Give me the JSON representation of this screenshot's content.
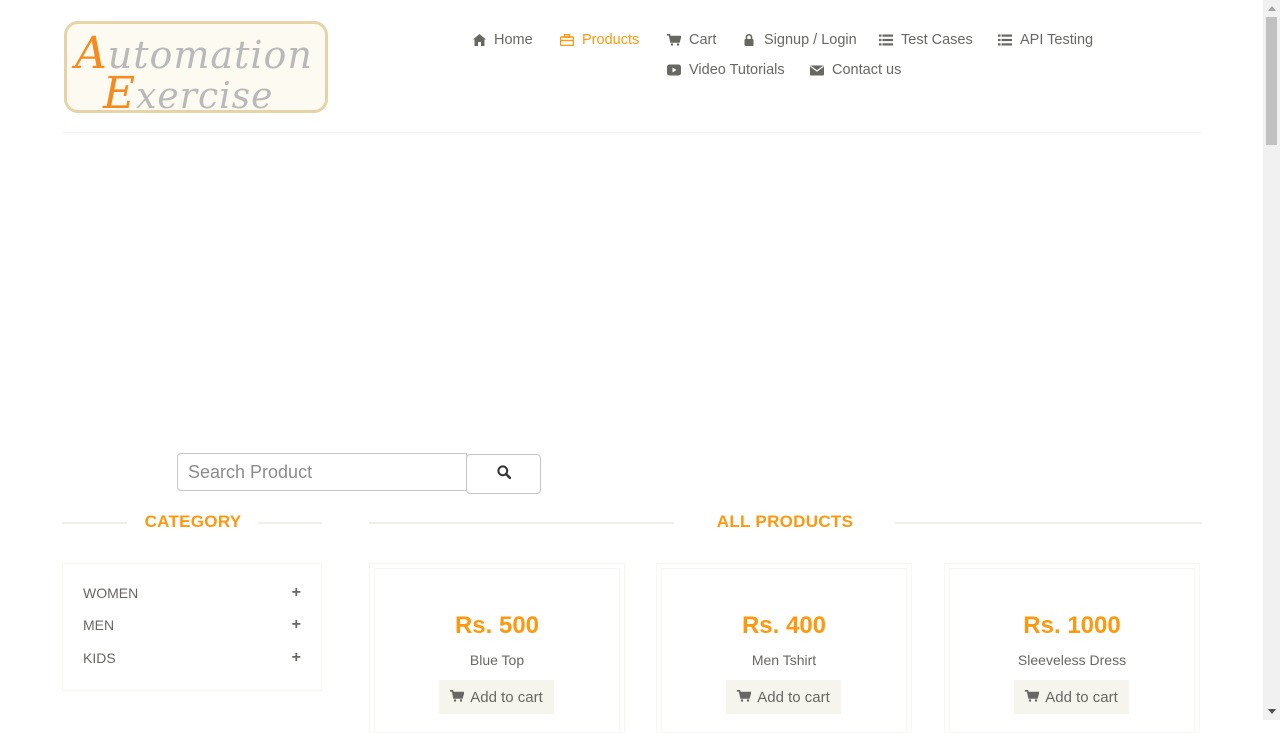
{
  "logo": {
    "line1_cap": "A",
    "line1_rest": "utomation",
    "line2_cap": "E",
    "line2_rest": "xercise"
  },
  "nav": {
    "home": "Home",
    "products": "Products",
    "cart": "Cart",
    "signup_login": "Signup / Login",
    "test_cases": "Test Cases",
    "api_testing": "API Testing",
    "video_tutorials": "Video Tutorials",
    "contact_us": "Contact us"
  },
  "search": {
    "placeholder": "Search Product",
    "value": ""
  },
  "category": {
    "title": "CATEGORY",
    "items": [
      {
        "label": "WOMEN",
        "icon": "plus-icon"
      },
      {
        "label": "MEN",
        "icon": "plus-icon"
      },
      {
        "label": "KIDS",
        "icon": "plus-icon"
      }
    ]
  },
  "products": {
    "title": "ALL PRODUCTS",
    "items": [
      {
        "price": "Rs. 500",
        "name": "Blue Top",
        "button": "Add to cart"
      },
      {
        "price": "Rs. 400",
        "name": "Men Tshirt",
        "button": "Add to cart"
      },
      {
        "price": "Rs. 1000",
        "name": "Sleeveless Dress",
        "button": "Add to cart"
      }
    ]
  },
  "colors": {
    "accent": "#fe980f",
    "text": "#696763",
    "logo_accent": "#f58a1f"
  }
}
